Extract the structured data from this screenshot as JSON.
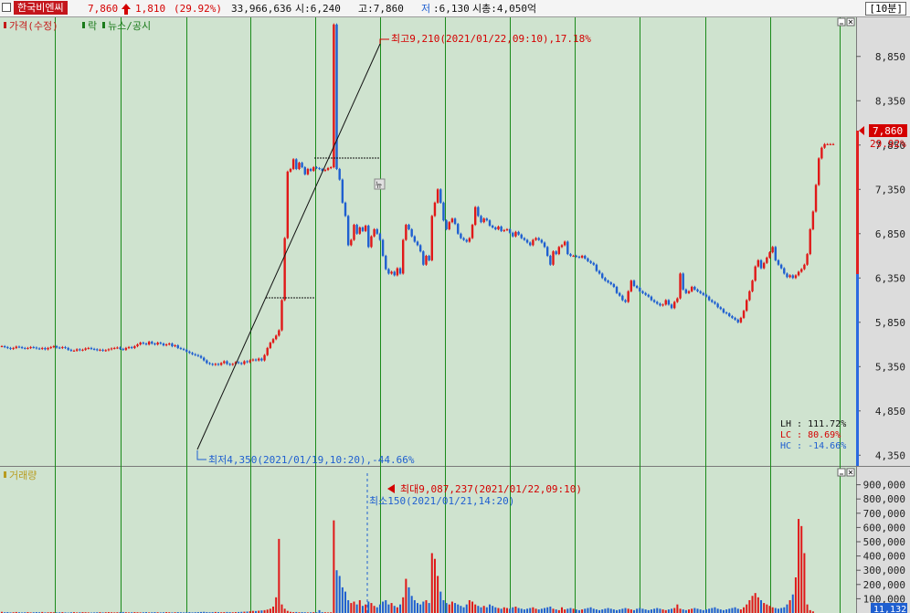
{
  "header": {
    "stock_name": "한국비엔씨",
    "price": "7,860",
    "change_arrow": "arrow-up-icon",
    "change": "1,810",
    "change_pct": "(29.92%)",
    "volume": "33,966,636",
    "open": "시:6,240",
    "high": "고:7,860",
    "low_label": "저",
    "low_value": ":6,130",
    "market_cap": "시총:4,050억",
    "period": "[10분]"
  },
  "legend": {
    "price": "가격(수정)",
    "drop": "락",
    "news": "뉴스/공시",
    "volume": "거래량"
  },
  "annotations": {
    "high": "최고9,210(2021/01/22,09:10),17.18%",
    "low": "최저4,350(2021/01/19,10:20),-44.66%",
    "vol_max": "최대9,087,237(2021/01/22,09:10)",
    "vol_min": "최소150(2021/01/21,14:20)",
    "news_marker": "뉴",
    "current_price": "7,860",
    "current_pct": "29.92%",
    "lh": "LH :  111.72%",
    "lc": "LC :   80.69%",
    "hc": "HC :  -14.66%",
    "vol_axis_last": "11,132"
  },
  "colors": {
    "bg": "#cfe3cf",
    "grid": "#1a8a1a",
    "up": "#e01818",
    "down": "#1f5fd0",
    "axis_bg": "#dcdcdc"
  },
  "chart_data": [
    {
      "type": "line",
      "title": "",
      "x_unit": "10-minute bar",
      "x_range": [
        "2021/01/18",
        "2021/01/25"
      ],
      "y_ticks": [
        4350,
        4850,
        5350,
        5850,
        6350,
        6850,
        7350,
        7850,
        8350,
        8850
      ],
      "ylim": [
        4250,
        9260
      ],
      "series": [
        {
          "name": "가격(수정)",
          "close": [
            5580,
            5570,
            5560,
            5550,
            5560,
            5575,
            5570,
            5560,
            5555,
            5560,
            5570,
            5565,
            5555,
            5550,
            5560,
            5545,
            5560,
            5570,
            5580,
            5565,
            5560,
            5570,
            5560,
            5540,
            5530,
            5530,
            5545,
            5535,
            5540,
            5555,
            5560,
            5550,
            5545,
            5535,
            5540,
            5530,
            5535,
            5545,
            5555,
            5560,
            5565,
            5550,
            5540,
            5560,
            5570,
            5560,
            5580,
            5600,
            5620,
            5610,
            5600,
            5630,
            5610,
            5600,
            5620,
            5610,
            5590,
            5600,
            5610,
            5580,
            5590,
            5560,
            5550,
            5540,
            5520,
            5505,
            5490,
            5480,
            5470,
            5450,
            5420,
            5390,
            5380,
            5370,
            5380,
            5370,
            5390,
            5410,
            5380,
            5370,
            5380,
            5400,
            5390,
            5380,
            5410,
            5400,
            5420,
            5430,
            5420,
            5440,
            5420,
            5480,
            5560,
            5620,
            5660,
            5700,
            5760,
            6100,
            6800,
            7550,
            7580,
            7690,
            7580,
            7650,
            7600,
            7520,
            7580,
            7560,
            7600,
            7590,
            7580,
            7560,
            7570,
            7590,
            7600,
            9210,
            7580,
            7460,
            7200,
            7050,
            6720,
            6780,
            6950,
            6850,
            6920,
            6880,
            6940,
            6700,
            6820,
            6900,
            6850,
            6780,
            6600,
            6450,
            6400,
            6420,
            6380,
            6460,
            6400,
            6780,
            6950,
            6900,
            6820,
            6760,
            6720,
            6650,
            6500,
            6600,
            6550,
            7050,
            7200,
            7350,
            7200,
            7000,
            6900,
            6980,
            7020,
            6960,
            6850,
            6800,
            6780,
            6760,
            6800,
            6950,
            7150,
            7050,
            6980,
            7020,
            7000,
            6940,
            6920,
            6900,
            6930,
            6880,
            6890,
            6900,
            6860,
            6820,
            6870,
            6840,
            6800,
            6780,
            6750,
            6720,
            6780,
            6800,
            6780,
            6750,
            6700,
            6600,
            6500,
            6650,
            6620,
            6700,
            6720,
            6760,
            6620,
            6600,
            6600,
            6590,
            6580,
            6600,
            6570,
            6540,
            6520,
            6500,
            6430,
            6400,
            6350,
            6320,
            6300,
            6280,
            6250,
            6180,
            6150,
            6100,
            6080,
            6200,
            6320,
            6260,
            6240,
            6200,
            6180,
            6160,
            6140,
            6100,
            6080,
            6060,
            6040,
            6050,
            6100,
            6050,
            6010,
            6080,
            6120,
            6400,
            6220,
            6180,
            6200,
            6250,
            6220,
            6200,
            6180,
            6160,
            6140,
            6100,
            6080,
            6060,
            6020,
            6000,
            5960,
            5950,
            5920,
            5900,
            5880,
            5850,
            5900,
            5980,
            6100,
            6200,
            6320,
            6480,
            6550,
            6460,
            6520,
            6580,
            6640,
            6700,
            6550,
            6500,
            6460,
            6400,
            6360,
            6380,
            6350,
            6380,
            6420,
            6450,
            6500,
            6620,
            6900,
            7100,
            7400,
            7700,
            7820,
            7860,
            7860,
            7860,
            7860
          ]
        },
        {
          "name": "거래량",
          "y_ticks": [
            100000,
            200000,
            300000,
            400000,
            500000,
            600000,
            700000,
            800000,
            900000
          ],
          "ylim": [
            0,
            1000000
          ],
          "values": [
            8000,
            5000,
            6000,
            4000,
            5000,
            7000,
            5000,
            4000,
            5000,
            6000,
            4000,
            5000,
            6000,
            5000,
            7000,
            4000,
            5000,
            6000,
            5000,
            4000,
            5000,
            6000,
            4000,
            3000,
            5000,
            6000,
            4000,
            5000,
            6000,
            5000,
            4000,
            3000,
            4000,
            5000,
            6000,
            4000,
            5000,
            6000,
            5000,
            4000,
            5000,
            6000,
            7000,
            5000,
            4000,
            5000,
            6000,
            5000,
            4000,
            5000,
            6000,
            4000,
            5000,
            6000,
            5000,
            4000,
            5000,
            6000,
            5000,
            4000,
            5000,
            6000,
            5000,
            4000,
            5000,
            6000,
            4000,
            5000,
            6000,
            7000,
            8000,
            6000,
            5000,
            6000,
            7000,
            6000,
            5000,
            6000,
            7000,
            6000,
            5000,
            6000,
            7000,
            8000,
            9000,
            10000,
            12000,
            15000,
            14000,
            16000,
            18000,
            20000,
            24000,
            30000,
            45000,
            110000,
            520000,
            60000,
            30000,
            15000,
            8000,
            6000,
            7000,
            5000,
            6000,
            5000,
            4000,
            5000,
            6000,
            5000,
            20000,
            6000,
            5000,
            4000,
            5000,
            650000,
            300000,
            260000,
            180000,
            150000,
            90000,
            70000,
            80000,
            60000,
            90000,
            50000,
            60000,
            80000,
            70000,
            50000,
            40000,
            60000,
            80000,
            90000,
            60000,
            70000,
            50000,
            40000,
            60000,
            110000,
            240000,
            180000,
            120000,
            90000,
            70000,
            60000,
            80000,
            90000,
            70000,
            420000,
            380000,
            260000,
            150000,
            90000,
            70000,
            60000,
            80000,
            70000,
            60000,
            50000,
            40000,
            60000,
            90000,
            80000,
            60000,
            50000,
            40000,
            50000,
            40000,
            60000,
            50000,
            40000,
            35000,
            30000,
            40000,
            35000,
            30000,
            40000,
            45000,
            35000,
            30000,
            25000,
            30000,
            35000,
            40000,
            30000,
            25000,
            30000,
            35000,
            40000,
            45000,
            30000,
            25000,
            20000,
            40000,
            25000,
            30000,
            35000,
            30000,
            25000,
            20000,
            25000,
            30000,
            35000,
            40000,
            30000,
            25000,
            20000,
            25000,
            30000,
            35000,
            30000,
            25000,
            20000,
            25000,
            30000,
            35000,
            30000,
            25000,
            20000,
            30000,
            35000,
            30000,
            25000,
            20000,
            25000,
            30000,
            35000,
            30000,
            25000,
            20000,
            25000,
            30000,
            35000,
            60000,
            30000,
            25000,
            20000,
            25000,
            30000,
            35000,
            30000,
            25000,
            20000,
            25000,
            30000,
            35000,
            40000,
            30000,
            25000,
            20000,
            25000,
            30000,
            35000,
            40000,
            30000,
            25000,
            40000,
            60000,
            90000,
            120000,
            140000,
            110000,
            90000,
            70000,
            60000,
            50000,
            40000,
            35000,
            30000,
            35000,
            40000,
            60000,
            90000,
            130000,
            250000,
            660000,
            610000,
            420000,
            60000,
            20000,
            11132
          ]
        }
      ]
    }
  ]
}
